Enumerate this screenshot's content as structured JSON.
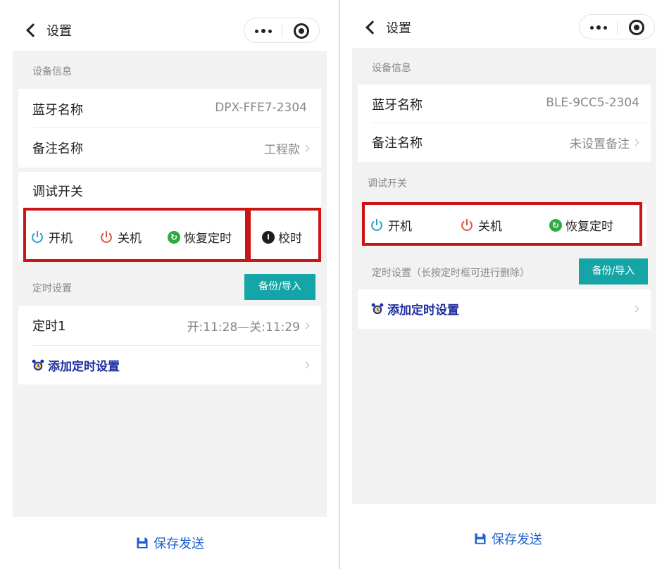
{
  "left": {
    "nav": {
      "title": "设置"
    },
    "device_info": {
      "section_title": "设备信息",
      "bluetooth": {
        "label": "蓝牙名称",
        "value": "DPX-FFE7-2304"
      },
      "remark": {
        "label": "备注名称",
        "value": "工程款"
      }
    },
    "debug": {
      "title": "调试开关",
      "power_on": "开机",
      "power_off": "关机",
      "restore_timer": "恢复定时",
      "sync_time": "校时"
    },
    "timer": {
      "section_title": "定时设置",
      "backup_button": "备份/导入",
      "items": [
        {
          "label": "定时1",
          "value": "开:11:28—关:11:29"
        }
      ],
      "add_label": "添加定时设置"
    },
    "footer": {
      "save_label": "保存发送"
    }
  },
  "right": {
    "nav": {
      "title": "设置"
    },
    "device_info": {
      "section_title": "设备信息",
      "bluetooth": {
        "label": "蓝牙名称",
        "value": "BLE-9CC5-2304"
      },
      "remark": {
        "label": "备注名称",
        "value": "未设置备注"
      }
    },
    "debug": {
      "title": "调试开关",
      "power_on": "开机",
      "power_off": "关机",
      "restore_timer": "恢复定时"
    },
    "timer": {
      "section_title": "定时设置（长按定时框可进行删除）",
      "backup_button": "备份/导入",
      "add_label": "添加定时设置"
    },
    "footer": {
      "save_label": "保存发送"
    }
  },
  "colors": {
    "power_on_icon": "#2f9fc6",
    "power_off_icon": "#e0533e",
    "restore_icon": "#2eaa3e",
    "highlight_box": "#cc1414",
    "teal_button": "#16a5a6",
    "link_text": "#1f2fa0",
    "save_text": "#1f5fcf"
  },
  "icons": [
    "back-icon",
    "more-icon",
    "target-icon",
    "chevron-icon",
    "power-icon",
    "restore-icon",
    "info-icon",
    "alarm-clock-icon",
    "save-icon"
  ]
}
